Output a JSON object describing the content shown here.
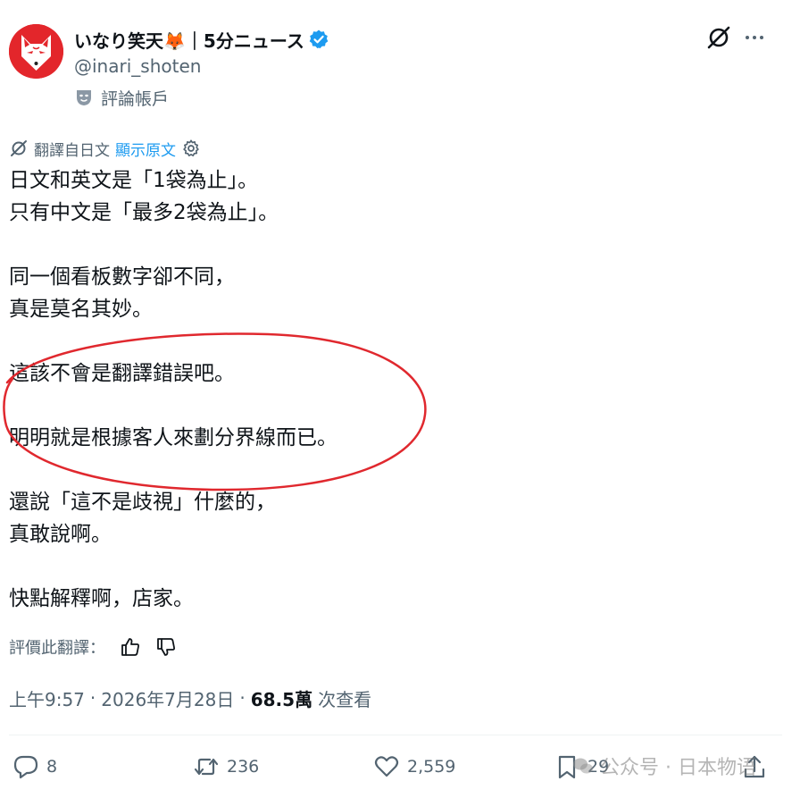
{
  "author": {
    "display_name": "いなり笑天🦊｜5分ニュース",
    "handle": "@inari_shoten",
    "label": "評論帳戶"
  },
  "translation": {
    "note": "翻譯自日文",
    "show_original": "顯示原文"
  },
  "body": [
    "日文和英文是「1袋為止」。",
    "只有中文是「最多2袋為止」。",
    "",
    "同一個看板數字卻不同，",
    "真是莫名其妙。",
    "",
    "這該不會是翻譯錯誤吧。",
    "",
    "明明就是根據客人來劃分界線而已。",
    "",
    "還說「這不是歧視」什麼的，",
    "真敢說啊。",
    "",
    "快點解釋啊，店家。"
  ],
  "rate": {
    "label": "評價此翻譯："
  },
  "meta": {
    "time": "上午9:57",
    "date": "2026年7月28日",
    "views": "68.5萬",
    "views_label": "次查看"
  },
  "actions": {
    "replies": "8",
    "reposts": "236",
    "likes": "2,559",
    "bookmarks": "29"
  },
  "watermark": {
    "text": "公众号 · 日本物语"
  },
  "colors": {
    "text": "#0f1419",
    "secondary": "#536471",
    "link": "#1d9bf0",
    "annotation_red": "#e0282e",
    "avatar_bg": "#e3262b"
  },
  "icons": [
    "fox-mask-avatar",
    "verified-badge-icon",
    "comedy-mask-icon",
    "grok-icon",
    "more-icon",
    "translate-icon",
    "gear-icon",
    "thumbs-up-icon",
    "thumbs-down-icon",
    "reply-icon",
    "repost-icon",
    "like-icon",
    "bookmark-icon",
    "share-icon"
  ]
}
